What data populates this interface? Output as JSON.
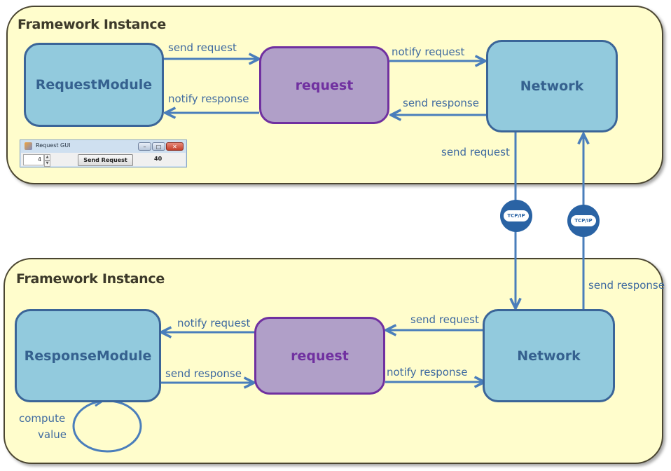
{
  "top_instance": {
    "title": "Framework Instance",
    "request_module": "RequestModule",
    "request": "request",
    "network": "Network",
    "edges": {
      "module_to_request": "send request",
      "request_to_module": "notify response",
      "request_to_network": "notify request",
      "network_to_request": "send response",
      "network_down": "send request"
    },
    "gui": {
      "window_title": "Request GUI",
      "spinner_value": "4",
      "spinner_up": "▲",
      "spinner_down": "▼",
      "send_button": "Send Request",
      "result": "40",
      "minimize": "–",
      "maximize": "□",
      "close": "✕"
    }
  },
  "bottom_instance": {
    "title": "Framework Instance",
    "response_module": "ResponseModule",
    "request": "request",
    "network": "Network",
    "edges": {
      "request_to_module": "notify request",
      "module_to_request": "send response",
      "network_to_request": "send request",
      "request_to_network": "notify response",
      "network_up": "send response",
      "self_loop_line1": "compute",
      "self_loop_line2": "value"
    }
  },
  "links": {
    "tcp_down": "TCP/IP",
    "tcp_up": "TCP/IP"
  },
  "colors": {
    "frame_fill": "#fffdcc",
    "module_fill": "#92cadd",
    "module_border": "#3b6598",
    "request_fill": "#b09fc8",
    "request_border": "#7030a0",
    "arrow": "#4a7ebb",
    "tcp": "#2a63a4"
  }
}
